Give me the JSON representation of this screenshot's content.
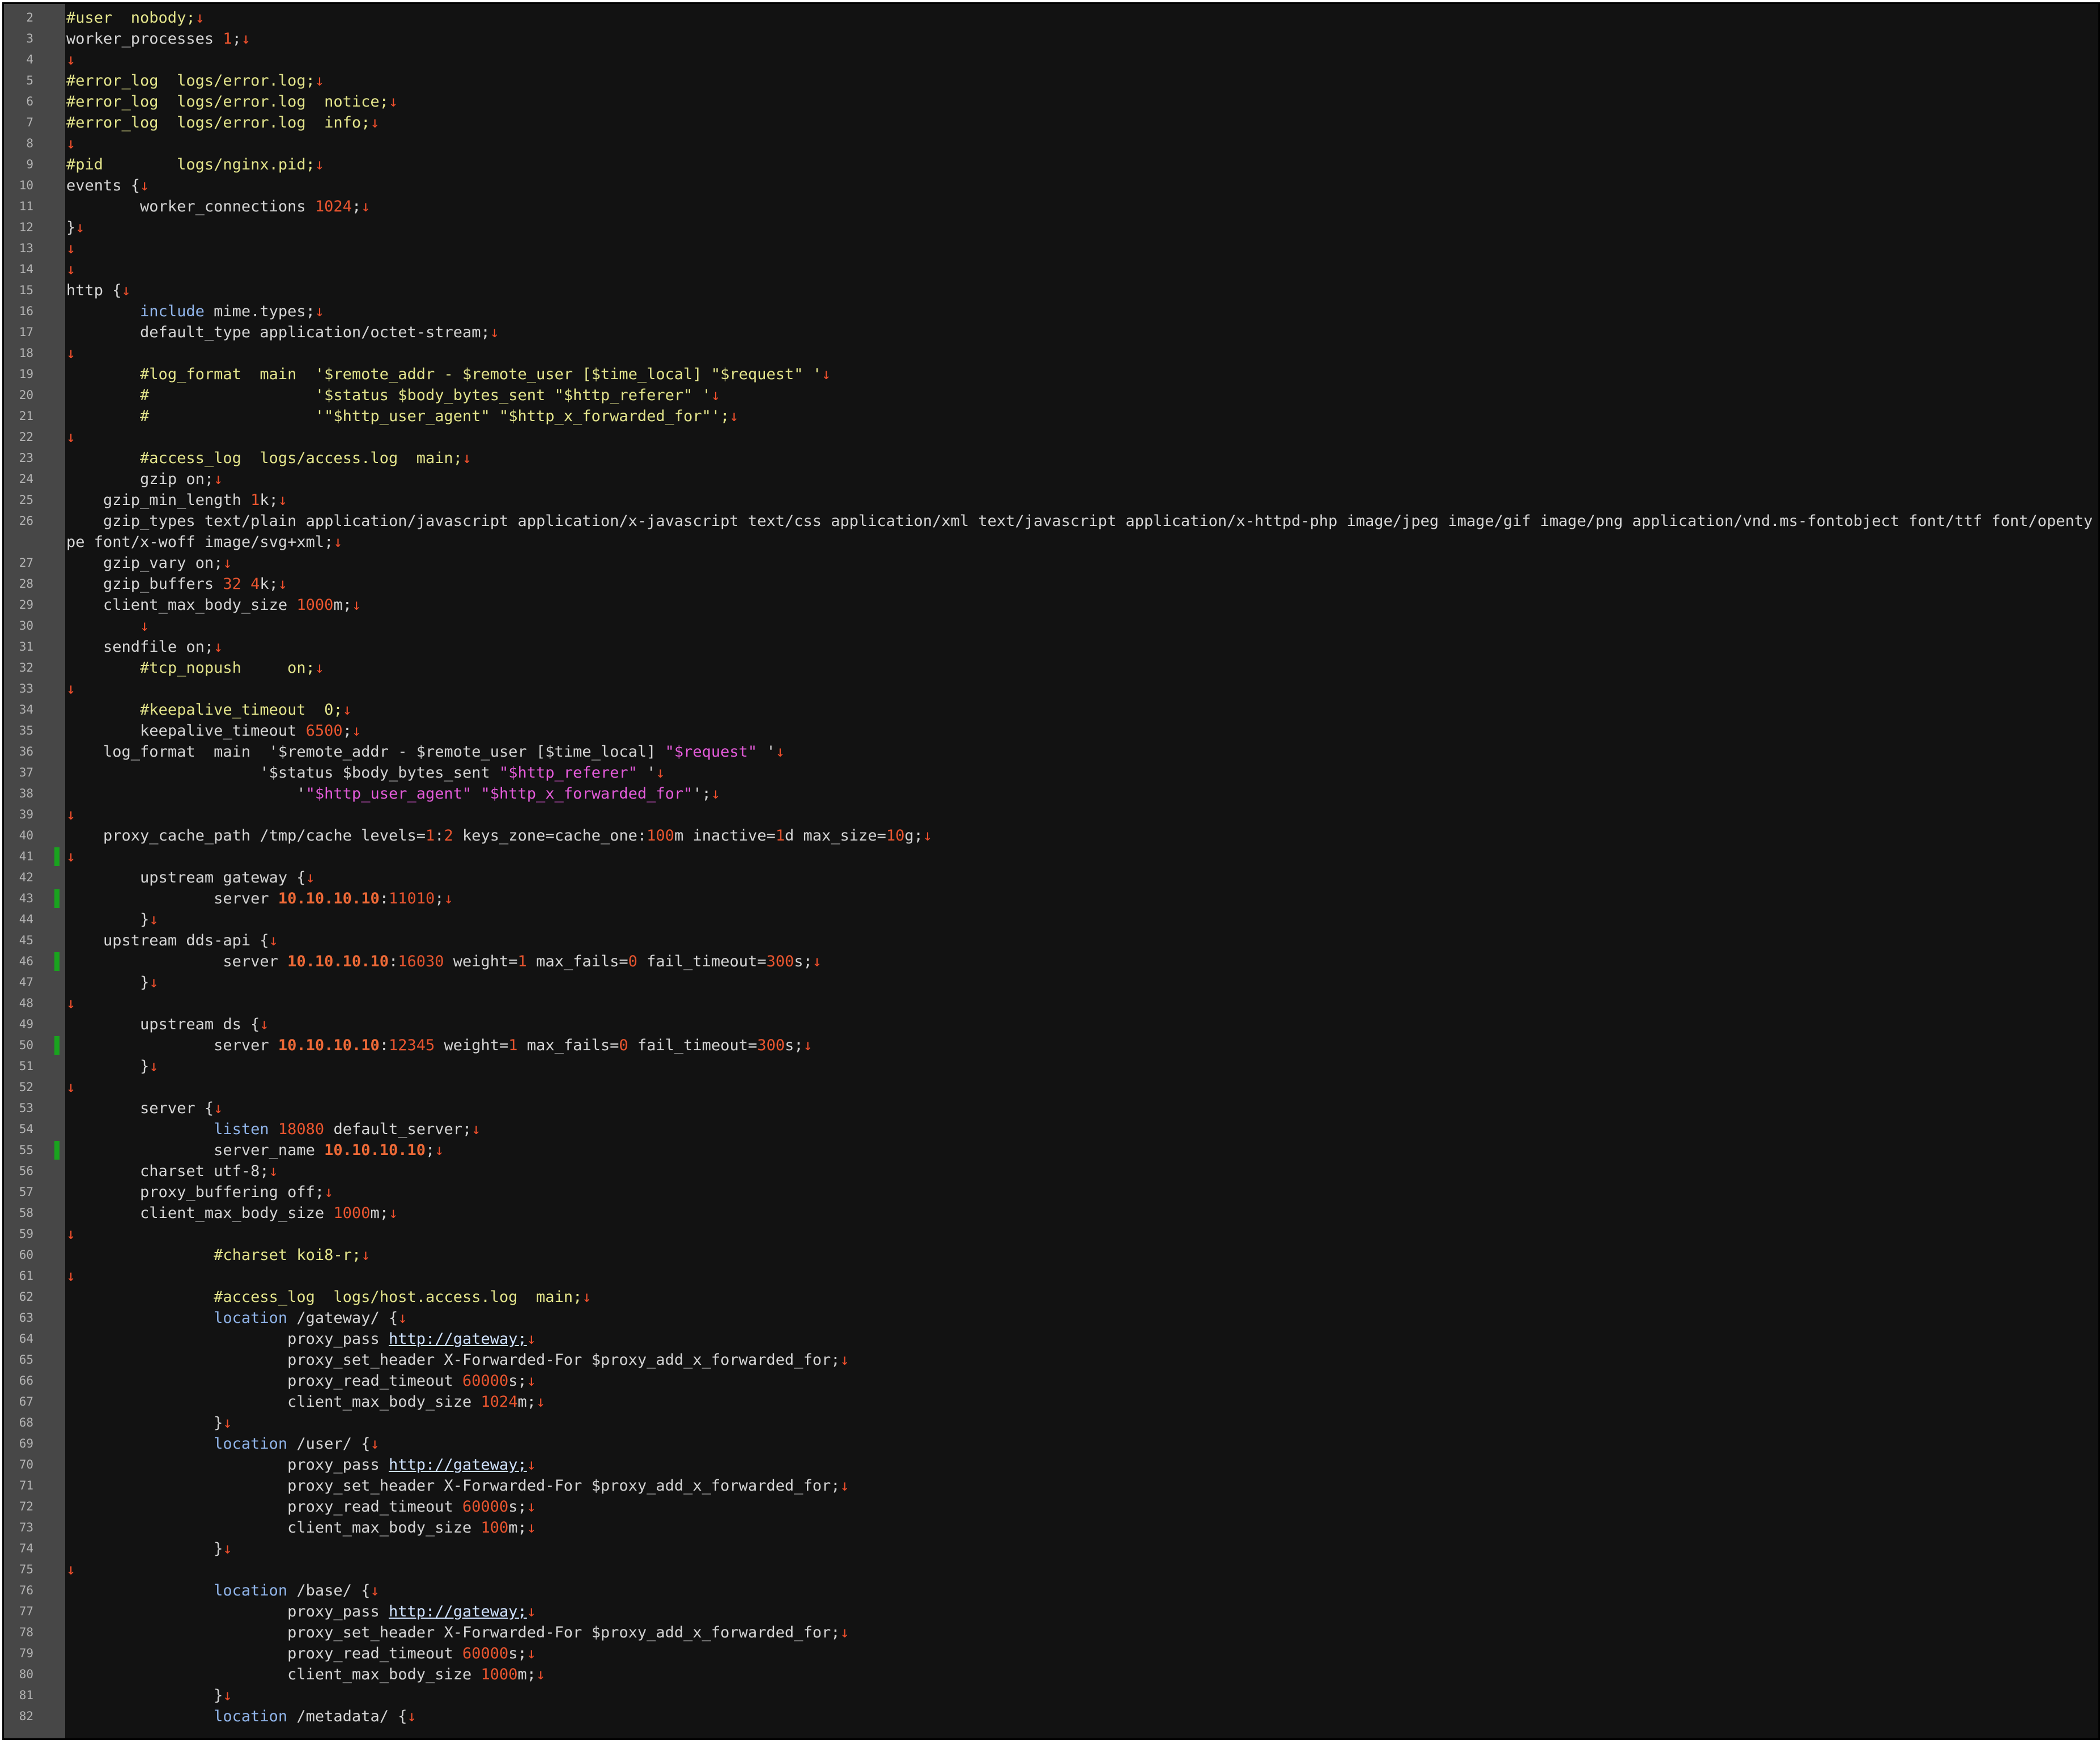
{
  "editor": {
    "theme_colors": {
      "background": "#121212",
      "gutter": "#474747",
      "comment": "#e2e38a",
      "number": "#e8552f",
      "keyword": "#8fb3e8",
      "string": "#e35bd9",
      "eol_marker": "#ee4f2c",
      "change_marker": "#19a31e"
    },
    "eol_glyph": "↓",
    "lines": [
      {
        "n": "2",
        "segs": [
          {
            "t": "#user  nobody;",
            "c": "c"
          }
        ]
      },
      {
        "n": "3",
        "segs": [
          {
            "t": "worker_processes "
          },
          {
            "t": "1",
            "c": "n"
          },
          {
            "t": ";"
          }
        ]
      },
      {
        "n": "4",
        "segs": []
      },
      {
        "n": "5",
        "segs": [
          {
            "t": "#error_log  logs/error.log;",
            "c": "c"
          }
        ]
      },
      {
        "n": "6",
        "segs": [
          {
            "t": "#error_log  logs/error.log  notice;",
            "c": "c"
          }
        ]
      },
      {
        "n": "7",
        "segs": [
          {
            "t": "#error_log  logs/error.log  info;",
            "c": "c"
          }
        ]
      },
      {
        "n": "8",
        "segs": []
      },
      {
        "n": "9",
        "segs": [
          {
            "t": "#pid        logs/nginx.pid;",
            "c": "c"
          }
        ]
      },
      {
        "n": "10",
        "segs": [
          {
            "t": "events {"
          }
        ]
      },
      {
        "n": "11",
        "segs": [
          {
            "t": "        worker_connections "
          },
          {
            "t": "1024",
            "c": "n"
          },
          {
            "t": ";"
          }
        ]
      },
      {
        "n": "12",
        "segs": [
          {
            "t": "}"
          }
        ]
      },
      {
        "n": "13",
        "segs": []
      },
      {
        "n": "14",
        "segs": []
      },
      {
        "n": "15",
        "segs": [
          {
            "t": "http {"
          }
        ]
      },
      {
        "n": "16",
        "segs": [
          {
            "t": "        "
          },
          {
            "t": "include",
            "c": "k"
          },
          {
            "t": " mime.types;"
          }
        ]
      },
      {
        "n": "17",
        "segs": [
          {
            "t": "        default_type application/octet-stream;"
          }
        ]
      },
      {
        "n": "18",
        "segs": []
      },
      {
        "n": "19",
        "segs": [
          {
            "t": "        #log_format  main  '$remote_addr - $remote_user [$time_local] \"$request\" '",
            "c": "c"
          }
        ]
      },
      {
        "n": "20",
        "segs": [
          {
            "t": "        #                  '$status $body_bytes_sent \"$http_referer\" '",
            "c": "c"
          }
        ]
      },
      {
        "n": "21",
        "segs": [
          {
            "t": "        #                  '\"$http_user_agent\" \"$http_x_forwarded_for\"';",
            "c": "c"
          }
        ]
      },
      {
        "n": "22",
        "segs": []
      },
      {
        "n": "23",
        "segs": [
          {
            "t": "        #access_log  logs/access.log  main;",
            "c": "c"
          }
        ]
      },
      {
        "n": "24",
        "segs": [
          {
            "t": "        gzip on;"
          }
        ]
      },
      {
        "n": "25",
        "segs": [
          {
            "t": "    gzip_min_length "
          },
          {
            "t": "1",
            "c": "n"
          },
          {
            "t": "k;"
          }
        ]
      },
      {
        "n": "26",
        "wrap": true,
        "segs": [
          {
            "t": "    gzip_types text/plain application/javascript application/x-javascript text/css application/xml text/javascript application/x-httpd-php image/jpeg image/gif image/png application/vnd.ms-fontobject font/ttf font/opentype font/x-woff image/svg+xml;"
          }
        ]
      },
      {
        "n": "27",
        "segs": [
          {
            "t": "    gzip_vary on;"
          }
        ]
      },
      {
        "n": "28",
        "segs": [
          {
            "t": "    gzip_buffers "
          },
          {
            "t": "32",
            "c": "n"
          },
          {
            "t": " "
          },
          {
            "t": "4",
            "c": "n"
          },
          {
            "t": "k;"
          }
        ]
      },
      {
        "n": "29",
        "segs": [
          {
            "t": "    client_max_body_size "
          },
          {
            "t": "1000",
            "c": "n"
          },
          {
            "t": "m;"
          }
        ]
      },
      {
        "n": "30",
        "segs": [
          {
            "t": "        "
          }
        ]
      },
      {
        "n": "31",
        "segs": [
          {
            "t": "    sendfile on;"
          }
        ]
      },
      {
        "n": "32",
        "segs": [
          {
            "t": "        "
          },
          {
            "t": "#tcp_nopush     on;",
            "c": "c"
          }
        ]
      },
      {
        "n": "33",
        "segs": []
      },
      {
        "n": "34",
        "segs": [
          {
            "t": "        "
          },
          {
            "t": "#keepalive_timeout  0;",
            "c": "c"
          }
        ]
      },
      {
        "n": "35",
        "segs": [
          {
            "t": "        keepalive_timeout "
          },
          {
            "t": "6500",
            "c": "n"
          },
          {
            "t": ";"
          }
        ]
      },
      {
        "n": "36",
        "segs": [
          {
            "t": "    log_format  main  '$remote_addr - $remote_user [$time_local] "
          },
          {
            "t": "\"$request\"",
            "c": "s"
          },
          {
            "t": " '"
          }
        ]
      },
      {
        "n": "37",
        "segs": [
          {
            "t": "                     '$status $body_bytes_sent "
          },
          {
            "t": "\"$http_referer\"",
            "c": "s"
          },
          {
            "t": " '"
          }
        ]
      },
      {
        "n": "38",
        "segs": [
          {
            "t": "                         '"
          },
          {
            "t": "\"$http_user_agent\" \"$http_x_forwarded_for\"",
            "c": "s"
          },
          {
            "t": "';"
          }
        ]
      },
      {
        "n": "39",
        "segs": []
      },
      {
        "n": "40",
        "segs": [
          {
            "t": "    proxy_cache_path /tmp/cache levels="
          },
          {
            "t": "1",
            "c": "n"
          },
          {
            "t": ":"
          },
          {
            "t": "2",
            "c": "n"
          },
          {
            "t": " keys_zone=cache_one:"
          },
          {
            "t": "100",
            "c": "n"
          },
          {
            "t": "m inactive="
          },
          {
            "t": "1",
            "c": "n"
          },
          {
            "t": "d max_size="
          },
          {
            "t": "10",
            "c": "n"
          },
          {
            "t": "g;"
          }
        ]
      },
      {
        "n": "41",
        "mark": true,
        "segs": []
      },
      {
        "n": "42",
        "segs": [
          {
            "t": "        upstream gateway {"
          }
        ]
      },
      {
        "n": "43",
        "mark": true,
        "segs": [
          {
            "t": "                server "
          },
          {
            "t": "10.10.10.10",
            "c": "ip"
          },
          {
            "t": ":"
          },
          {
            "t": "11010",
            "c": "n"
          },
          {
            "t": ";"
          }
        ]
      },
      {
        "n": "44",
        "segs": [
          {
            "t": "        }"
          }
        ]
      },
      {
        "n": "45",
        "segs": [
          {
            "t": "    upstream dds-api {"
          }
        ]
      },
      {
        "n": "46",
        "mark": true,
        "segs": [
          {
            "t": "                 server "
          },
          {
            "t": "10.10.10.10",
            "c": "ip"
          },
          {
            "t": ":"
          },
          {
            "t": "16030",
            "c": "n"
          },
          {
            "t": " weight="
          },
          {
            "t": "1",
            "c": "n"
          },
          {
            "t": " max_fails="
          },
          {
            "t": "0",
            "c": "n"
          },
          {
            "t": " fail_timeout="
          },
          {
            "t": "300",
            "c": "n"
          },
          {
            "t": "s;"
          }
        ]
      },
      {
        "n": "47",
        "segs": [
          {
            "t": "        }"
          }
        ]
      },
      {
        "n": "48",
        "segs": []
      },
      {
        "n": "49",
        "segs": [
          {
            "t": "        upstream ds {"
          }
        ]
      },
      {
        "n": "50",
        "mark": true,
        "segs": [
          {
            "t": "                server "
          },
          {
            "t": "10.10.10.10",
            "c": "ip"
          },
          {
            "t": ":"
          },
          {
            "t": "12345",
            "c": "n"
          },
          {
            "t": " weight="
          },
          {
            "t": "1",
            "c": "n"
          },
          {
            "t": " max_fails="
          },
          {
            "t": "0",
            "c": "n"
          },
          {
            "t": " fail_timeout="
          },
          {
            "t": "300",
            "c": "n"
          },
          {
            "t": "s;"
          }
        ]
      },
      {
        "n": "51",
        "segs": [
          {
            "t": "        }"
          }
        ]
      },
      {
        "n": "52",
        "segs": []
      },
      {
        "n": "53",
        "segs": [
          {
            "t": "        server {"
          }
        ]
      },
      {
        "n": "54",
        "segs": [
          {
            "t": "                "
          },
          {
            "t": "listen",
            "c": "k"
          },
          {
            "t": " "
          },
          {
            "t": "18080",
            "c": "n"
          },
          {
            "t": " default_server;"
          }
        ]
      },
      {
        "n": "55",
        "mark": true,
        "segs": [
          {
            "t": "                server_name "
          },
          {
            "t": "10.10.10.10",
            "c": "ip"
          },
          {
            "t": ";"
          }
        ]
      },
      {
        "n": "56",
        "segs": [
          {
            "t": "        charset utf-8;"
          }
        ]
      },
      {
        "n": "57",
        "segs": [
          {
            "t": "        proxy_buffering off;"
          }
        ]
      },
      {
        "n": "58",
        "segs": [
          {
            "t": "        client_max_body_size "
          },
          {
            "t": "1000",
            "c": "n"
          },
          {
            "t": "m;"
          }
        ]
      },
      {
        "n": "59",
        "segs": []
      },
      {
        "n": "60",
        "segs": [
          {
            "t": "                "
          },
          {
            "t": "#charset koi8-r;",
            "c": "c"
          }
        ]
      },
      {
        "n": "61",
        "segs": []
      },
      {
        "n": "62",
        "segs": [
          {
            "t": "                "
          },
          {
            "t": "#access_log  logs/host.access.log  main;",
            "c": "c"
          }
        ]
      },
      {
        "n": "63",
        "segs": [
          {
            "t": "                "
          },
          {
            "t": "location",
            "c": "k"
          },
          {
            "t": " /gateway/ {"
          }
        ]
      },
      {
        "n": "64",
        "segs": [
          {
            "t": "                        proxy_pass "
          },
          {
            "t": "http://gateway;",
            "c": "u"
          }
        ]
      },
      {
        "n": "65",
        "segs": [
          {
            "t": "                        proxy_set_header X-Forwarded-For $proxy_add_x_forwarded_for;"
          }
        ]
      },
      {
        "n": "66",
        "segs": [
          {
            "t": "                        proxy_read_timeout "
          },
          {
            "t": "60000",
            "c": "n"
          },
          {
            "t": "s;"
          }
        ]
      },
      {
        "n": "67",
        "segs": [
          {
            "t": "                        client_max_body_size "
          },
          {
            "t": "1024",
            "c": "n"
          },
          {
            "t": "m;"
          }
        ]
      },
      {
        "n": "68",
        "segs": [
          {
            "t": "                }"
          }
        ]
      },
      {
        "n": "69",
        "segs": [
          {
            "t": "                "
          },
          {
            "t": "location",
            "c": "k"
          },
          {
            "t": " /user/ {"
          }
        ]
      },
      {
        "n": "70",
        "segs": [
          {
            "t": "                        proxy_pass "
          },
          {
            "t": "http://gateway;",
            "c": "u"
          }
        ]
      },
      {
        "n": "71",
        "segs": [
          {
            "t": "                        proxy_set_header X-Forwarded-For $proxy_add_x_forwarded_for;"
          }
        ]
      },
      {
        "n": "72",
        "segs": [
          {
            "t": "                        proxy_read_timeout "
          },
          {
            "t": "60000",
            "c": "n"
          },
          {
            "t": "s;"
          }
        ]
      },
      {
        "n": "73",
        "segs": [
          {
            "t": "                        client_max_body_size "
          },
          {
            "t": "100",
            "c": "n"
          },
          {
            "t": "m;"
          }
        ]
      },
      {
        "n": "74",
        "segs": [
          {
            "t": "                }"
          }
        ]
      },
      {
        "n": "75",
        "segs": []
      },
      {
        "n": "76",
        "segs": [
          {
            "t": "                "
          },
          {
            "t": "location",
            "c": "k"
          },
          {
            "t": " /base/ {"
          }
        ]
      },
      {
        "n": "77",
        "segs": [
          {
            "t": "                        proxy_pass "
          },
          {
            "t": "http://gateway;",
            "c": "u"
          }
        ]
      },
      {
        "n": "78",
        "segs": [
          {
            "t": "                        proxy_set_header X-Forwarded-For $proxy_add_x_forwarded_for;"
          }
        ]
      },
      {
        "n": "79",
        "segs": [
          {
            "t": "                        proxy_read_timeout "
          },
          {
            "t": "60000",
            "c": "n"
          },
          {
            "t": "s;"
          }
        ]
      },
      {
        "n": "80",
        "segs": [
          {
            "t": "                        client_max_body_size "
          },
          {
            "t": "1000",
            "c": "n"
          },
          {
            "t": "m;"
          }
        ]
      },
      {
        "n": "81",
        "segs": [
          {
            "t": "                }"
          }
        ]
      },
      {
        "n": "82",
        "segs": [
          {
            "t": "                "
          },
          {
            "t": "location",
            "c": "k"
          },
          {
            "t": " /metadata/ {"
          }
        ]
      }
    ]
  }
}
